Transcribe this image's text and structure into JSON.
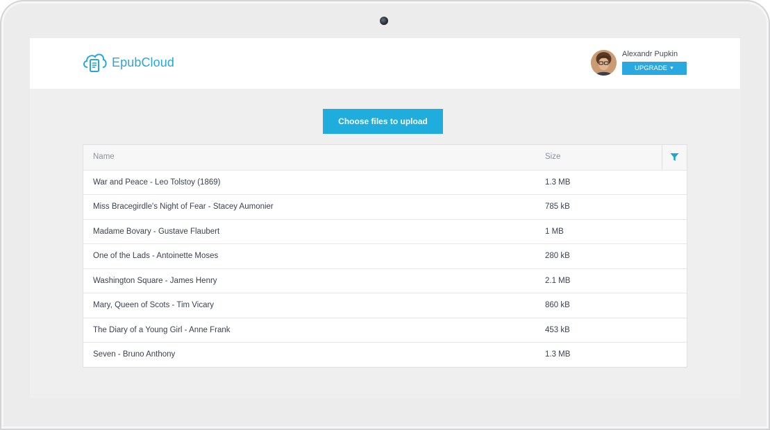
{
  "app": {
    "name": "EpubCloud",
    "accent_color": "#26a7dc"
  },
  "user": {
    "name": "Alexandr Pupkin",
    "upgrade_label": "UPGRADE",
    "upgrade_caret_icon": "caret-down-icon"
  },
  "upload": {
    "label": "Choose files to upload"
  },
  "table": {
    "columns": [
      "Name",
      "Size"
    ],
    "filter_icon": "filter-icon",
    "rows": [
      {
        "name": "War and Peace - Leo Tolstoy (1869)",
        "size": "1.3 MB"
      },
      {
        "name": "Miss Bracegirdle's Night of Fear -  Stacey Aumonier",
        "size": "785 kB"
      },
      {
        "name": "Madame Bovary - Gustave Flaubert",
        "size": "1 MB"
      },
      {
        "name": "One of the Lads - Antoinette Moses",
        "size": "280 kB"
      },
      {
        "name": "Washington Square - James Henry",
        "size": "2.1 MB"
      },
      {
        "name": "Mary, Queen of Scots - Tim Vicary",
        "size": "860 kB"
      },
      {
        "name": "The Diary of a Young Girl - Anne Frank",
        "size": "453 kB"
      },
      {
        "name": "Seven - Bruno Anthony",
        "size": "1.3 MB"
      }
    ]
  }
}
